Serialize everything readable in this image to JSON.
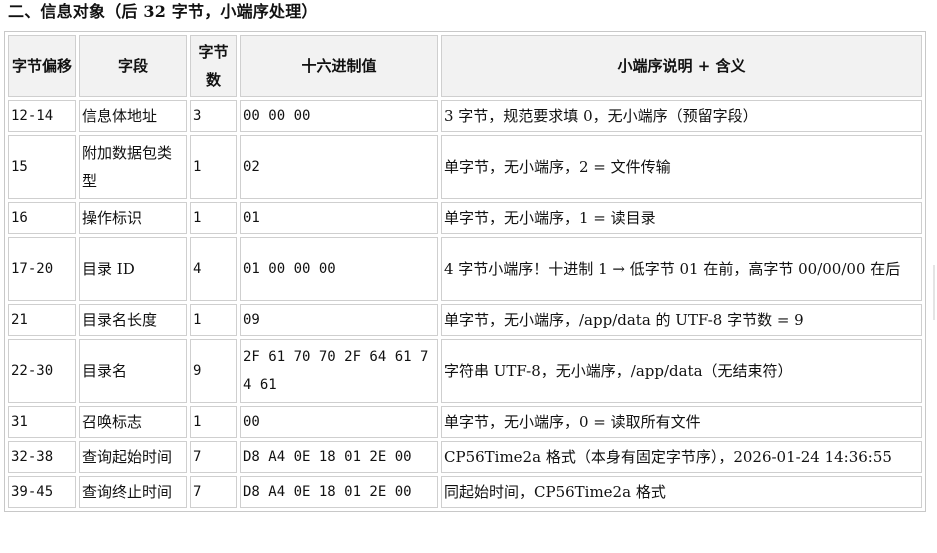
{
  "section_title": "二、信息对象（后 32 字节，小端序处理）",
  "table": {
    "headers": [
      "字节偏移",
      "字段",
      "字节数",
      "十六进制值",
      "小端序说明 + 含义"
    ],
    "rows": [
      {
        "offset": "12-14",
        "field": "信息体地址",
        "bytes": "3",
        "hex": "00 00 00",
        "desc": "3 字节，规范要求填 0，无小端序（预留字段）"
      },
      {
        "offset": "15",
        "field": "附加数据包类型",
        "bytes": "1",
        "hex": "02",
        "desc": "单字节，无小端序，2 = 文件传输"
      },
      {
        "offset": "16",
        "field": "操作标识",
        "bytes": "1",
        "hex": "01",
        "desc": "单字节，无小端序，1 = 读目录"
      },
      {
        "offset": "17-20",
        "field": "目录 ID",
        "bytes": "4",
        "hex": "01 00 00 00",
        "desc": "4 字节小端序！十进制 1 → 低字节 01 在前，高字节 00/00/00 在后"
      },
      {
        "offset": "21",
        "field": "目录名长度",
        "bytes": "1",
        "hex": "09",
        "desc": "单字节，无小端序，/app/data 的 UTF-8 字节数 = 9"
      },
      {
        "offset": "22-30",
        "field": "目录名",
        "bytes": "9",
        "hex": "2F 61 70 70 2F 64 61 74 61",
        "desc": "字符串 UTF-8，无小端序，/app/data（无结束符）"
      },
      {
        "offset": "31",
        "field": "召唤标志",
        "bytes": "1",
        "hex": "00",
        "desc": "单字节，无小端序，0 = 读取所有文件"
      },
      {
        "offset": "32-38",
        "field": "查询起始时间",
        "bytes": "7",
        "hex": "D8 A4 0E 18 01 2E 00",
        "desc": "CP56Time2a 格式（本身有固定字节序），2026-01-24 14:36:55"
      },
      {
        "offset": "39-45",
        "field": "查询终止时间",
        "bytes": "7",
        "hex": "D8 A4 0E 18 01 2E 00",
        "desc": "同起始时间，CP56Time2a 格式"
      }
    ]
  }
}
